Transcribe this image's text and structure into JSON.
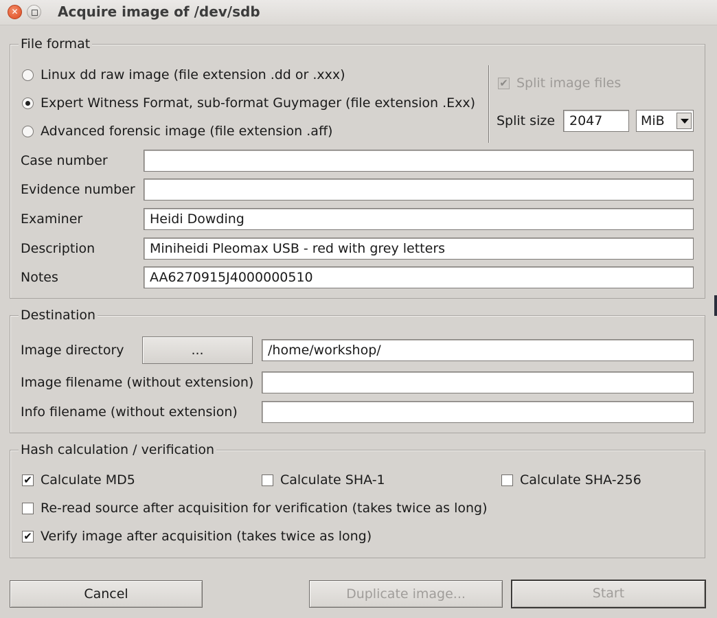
{
  "window": {
    "title": "Acquire image of /dev/sdb"
  },
  "file_format": {
    "legend": "File format",
    "options": [
      {
        "label": "Linux dd raw image (file extension .dd or .xxx)",
        "selected": false
      },
      {
        "label": "Expert Witness Format, sub-format Guymager (file extension .Exx)",
        "selected": true
      },
      {
        "label": "Advanced forensic image (file extension .aff)",
        "selected": false
      }
    ],
    "split_image_files": {
      "label": "Split image files",
      "checked": true,
      "enabled": false
    },
    "split_size": {
      "label": "Split size",
      "value": "2047",
      "unit": "MiB"
    },
    "fields": [
      {
        "label": "Case number",
        "value": ""
      },
      {
        "label": "Evidence number",
        "value": ""
      },
      {
        "label": "Examiner",
        "value": "Heidi Dowding"
      },
      {
        "label": "Description",
        "value": "Miniheidi Pleomax USB - red with grey letters"
      },
      {
        "label": "Notes",
        "value": "AA6270915J4000000510"
      }
    ]
  },
  "destination": {
    "legend": "Destination",
    "image_directory": {
      "label": "Image directory",
      "browse_label": "...",
      "value": "/home/workshop/"
    },
    "image_filename": {
      "label": "Image filename (without extension)",
      "value": ""
    },
    "info_filename": {
      "label": "Info filename (without extension)",
      "value": ""
    }
  },
  "hash": {
    "legend": "Hash calculation / verification",
    "md5": {
      "label": "Calculate MD5",
      "checked": true
    },
    "sha1": {
      "label": "Calculate SHA-1",
      "checked": false
    },
    "sha256": {
      "label": "Calculate SHA-256",
      "checked": false
    },
    "reread": {
      "label": "Re-read source after acquisition for verification (takes twice as long)",
      "checked": false
    },
    "verify": {
      "label": "Verify image after acquisition (takes twice as long)",
      "checked": true
    }
  },
  "buttons": {
    "cancel": "Cancel",
    "duplicate": "Duplicate image...",
    "start": "Start"
  }
}
